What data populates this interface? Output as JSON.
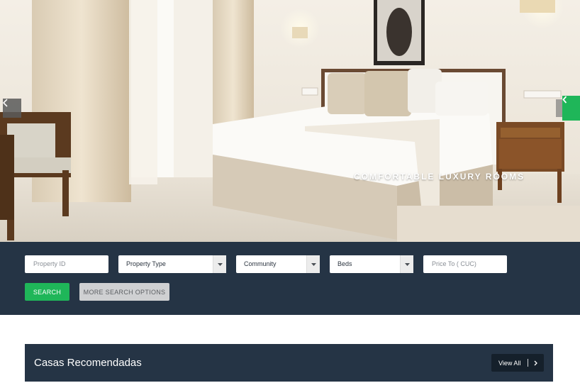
{
  "hero": {
    "caption": "COMFORTABLE LUXURY ROOMS",
    "prev_icon": "chevron-left-icon",
    "next_icon": "chevron-left-icon"
  },
  "search": {
    "property_id_placeholder": "Property ID",
    "property_type": "Property Type",
    "community": "Community",
    "beds": "Beds",
    "price_placeholder": "Price To ( CUC)",
    "search_label": "SEARCH",
    "more_label": "MORE SEARCH OPTIONS"
  },
  "recommended": {
    "title": "Casas Recomendadas",
    "view_all": "View All"
  },
  "colors": {
    "navy": "#253445",
    "accent_green": "#1fb659",
    "dark_button": "#15202b"
  }
}
